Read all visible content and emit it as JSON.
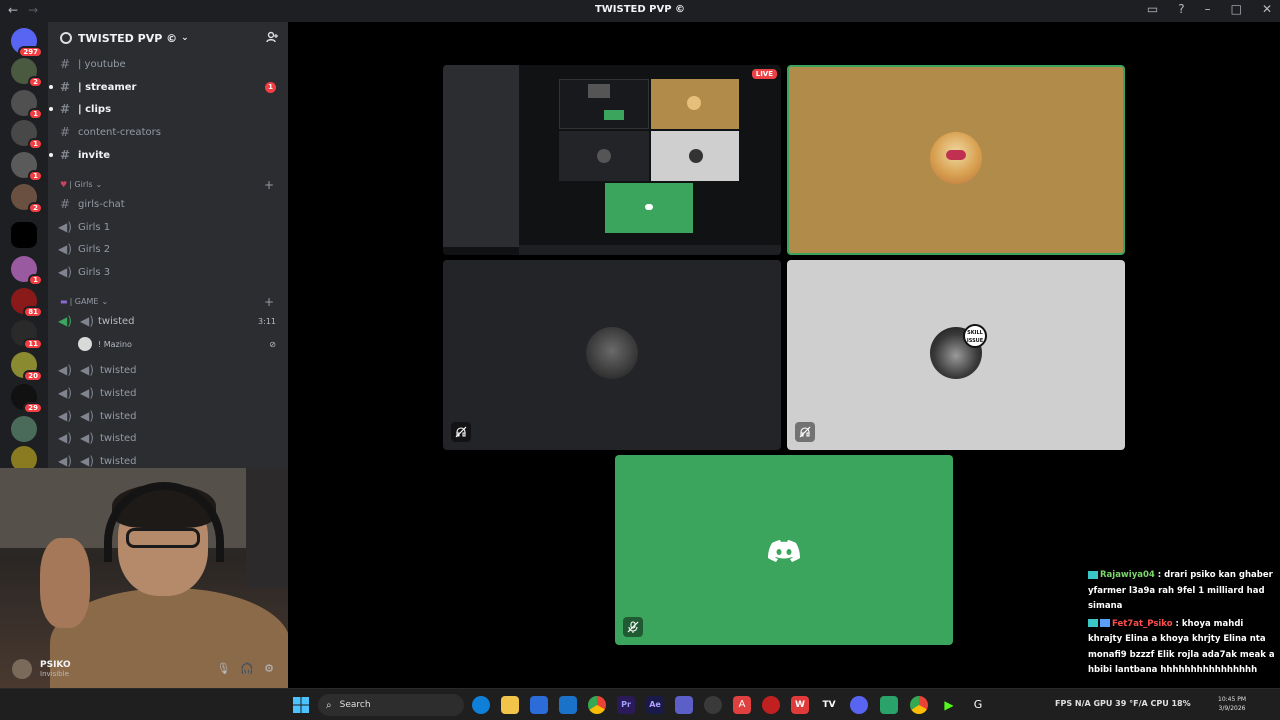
{
  "window": {
    "title": "TWISTED PVP ©"
  },
  "server_rail": {
    "badges": [
      "297",
      "2",
      "1",
      "1",
      "1",
      "2",
      "",
      "1",
      "81",
      "11",
      "20",
      "29",
      "",
      ""
    ]
  },
  "guild": {
    "name": "TWISTED PVP ©"
  },
  "channels": [
    {
      "name": "| youtube"
    },
    {
      "name": "| streamer",
      "badge": "1"
    },
    {
      "name": "| clips"
    },
    {
      "name": "content-creators"
    },
    {
      "name": "invite"
    }
  ],
  "category_girls": {
    "name": "| Girls"
  },
  "girls_channels": [
    {
      "name": "girls-chat"
    },
    {
      "name": "Girls 1"
    },
    {
      "name": "Girls 2"
    },
    {
      "name": "Girls 3"
    }
  ],
  "category_game": {
    "name": "| GAME"
  },
  "game_channels": [
    {
      "name": "twisted",
      "timer": "3:11"
    },
    {
      "name": "twisted"
    },
    {
      "name": "twisted"
    },
    {
      "name": "twisted"
    },
    {
      "name": "twisted"
    },
    {
      "name": "twisted"
    }
  ],
  "vc_user": {
    "name": "! Mazino"
  },
  "user_panel": {
    "name": "PSIKO",
    "status": "Invisible"
  },
  "stage": {
    "live_label": "LIVE",
    "skill_label": "SKILL ISSUE"
  },
  "chat": [
    {
      "user": "Rajawiya04",
      "text": ": drari psiko kan ghaber yfarmer l3a9a rah 9fel 1 milliard had simana"
    },
    {
      "user": "Fet7at_Psiko",
      "text": ": khoya mahdi khrajty Elina a khoya khrjty Elina nta monafi9 bzzzf Elik rojla ada7ak meak a hbibi lantbana hhhhhhhhhhhhhhhh"
    }
  ],
  "taskbar": {
    "search_label": "Search",
    "stats": "FPS N/A   GPU 39 °F/A  CPU 18%",
    "time": "10:45 PM",
    "date": "3/9/2026"
  },
  "colors": {
    "accent_green": "#3ba55d",
    "badge_red": "#f23f43",
    "gold_tile": "#b18b49"
  }
}
